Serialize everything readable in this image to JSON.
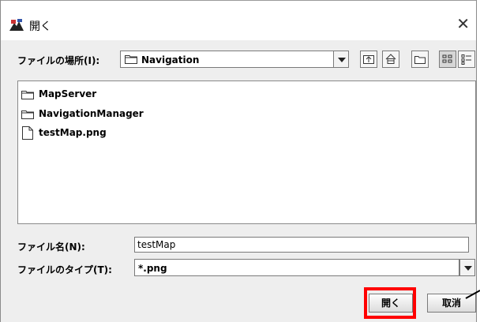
{
  "window": {
    "title": "開く"
  },
  "look_in": {
    "label": "ファイルの場所(I):",
    "value": "Navigation"
  },
  "files": [
    {
      "name": "MapServer",
      "type": "folder"
    },
    {
      "name": "NavigationManager",
      "type": "folder"
    },
    {
      "name": "testMap.png",
      "type": "file"
    }
  ],
  "file_name": {
    "label": "ファイル名(N):",
    "value": "testMap"
  },
  "file_type": {
    "label": "ファイルのタイプ(T):",
    "value": "*.png"
  },
  "buttons": {
    "open": "開く",
    "cancel": "取消"
  },
  "icons": {
    "app": "java-coffee-icon",
    "close": "close-icon",
    "folder": "folder-icon",
    "file": "file-icon",
    "up": "up-folder-icon",
    "home": "home-icon",
    "new_folder": "new-folder-icon",
    "list": "list-view-icon",
    "details": "details-view-icon"
  },
  "colors": {
    "highlight": "#ff0000"
  }
}
